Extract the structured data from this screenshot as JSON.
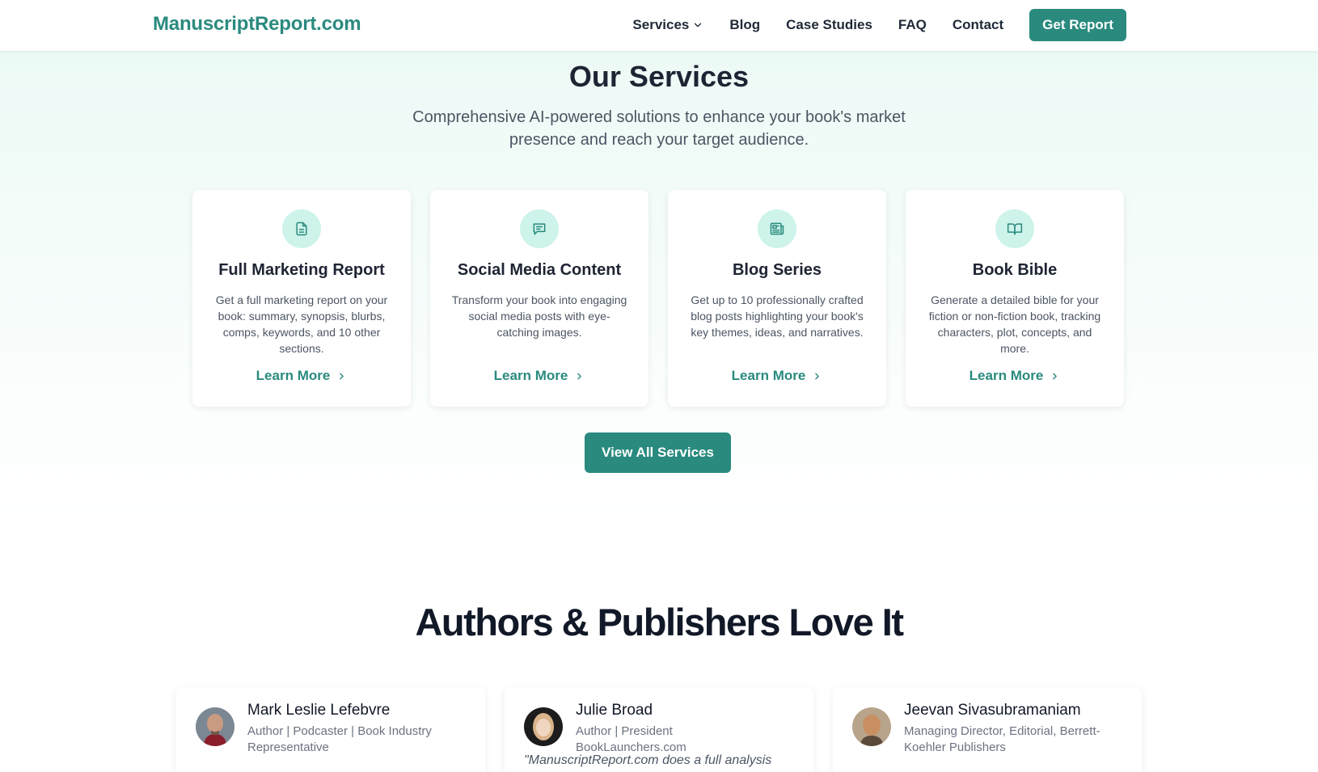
{
  "header": {
    "logo": "ManuscriptReport.com",
    "nav": [
      {
        "label": "Services"
      },
      {
        "label": "Blog"
      },
      {
        "label": "Case Studies"
      },
      {
        "label": "FAQ"
      },
      {
        "label": "Contact"
      }
    ],
    "cta": "Get Report"
  },
  "services": {
    "title": "Our Services",
    "subtitle": "Comprehensive AI-powered solutions to enhance your book's market presence and reach your target audience.",
    "cards": [
      {
        "icon": "document-icon",
        "title": "Full Marketing Report",
        "description": "Get a full marketing report on your book: summary, synopsis, blurbs, comps, keywords, and 10 other sections.",
        "link": "Learn More"
      },
      {
        "icon": "chat-icon",
        "title": "Social Media Content",
        "description": "Transform your book into engaging social media posts with eye-catching images.",
        "link": "Learn More"
      },
      {
        "icon": "newspaper-icon",
        "title": "Blog Series",
        "description": "Get up to 10 professionally crafted blog posts highlighting your book's key themes, ideas, and narratives.",
        "link": "Learn More"
      },
      {
        "icon": "open-book-icon",
        "title": "Book Bible",
        "description": "Generate a detailed bible for your fiction or non-fiction book, tracking characters, plot, concepts, and more.",
        "link": "Learn More"
      }
    ],
    "view_all": "View All Services"
  },
  "testimonials": {
    "title": "Authors & Publishers Love It",
    "items": [
      {
        "name": "Mark Leslie Lefebvre",
        "role": "Author | Podcaster | Book Industry Representative",
        "quote": ""
      },
      {
        "name": "Julie Broad",
        "role": "Author | President BookLaunchers.com",
        "quote": "\"ManuscriptReport.com does a full analysis"
      },
      {
        "name": "Jeevan Sivasubramaniam",
        "role": "Managing Director, Editorial, Berrett-Koehler Publishers",
        "quote": ""
      }
    ]
  },
  "colors": {
    "brand": "#2a8a7e",
    "icon_bg": "#cdf3ea",
    "heading": "#1e2433"
  }
}
